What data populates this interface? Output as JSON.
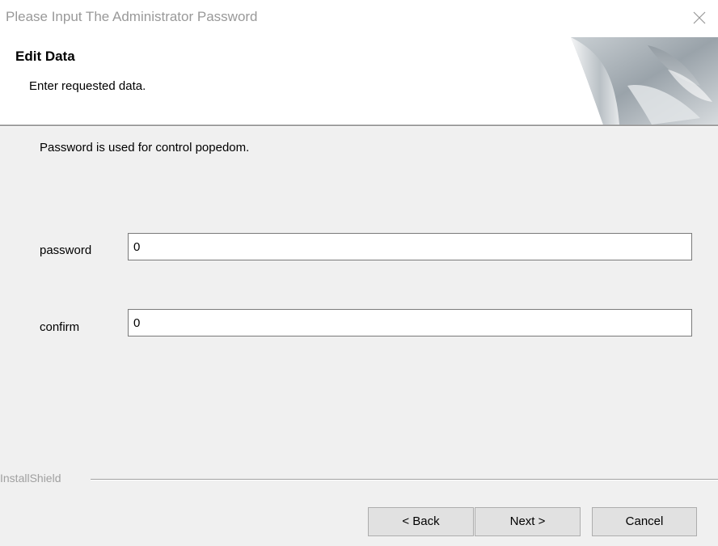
{
  "window": {
    "title": "Please Input The Administrator Password"
  },
  "header": {
    "title": "Edit Data",
    "subtitle": "Enter requested data."
  },
  "main": {
    "description": "Password is used for control popedom.",
    "fields": [
      {
        "label": "password",
        "value": "0"
      },
      {
        "label": "confirm",
        "value": "0"
      }
    ]
  },
  "footer": {
    "brand": "InstallShield",
    "back_label": "< Back",
    "next_label": "Next >",
    "cancel_label": "Cancel"
  },
  "icons": {
    "close": "close-icon",
    "header_graphic": "installshield-header-graphic"
  }
}
